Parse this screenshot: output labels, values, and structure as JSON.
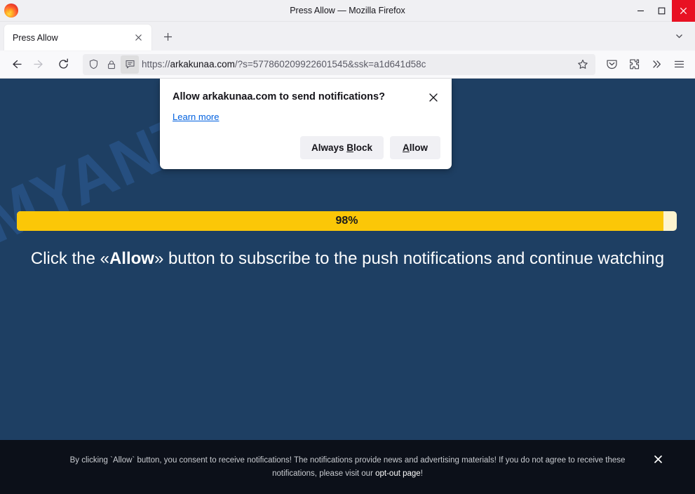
{
  "window": {
    "title": "Press Allow — Mozilla Firefox",
    "minimize_label": "Minimize",
    "maximize_label": "Maximize",
    "close_label": "Close"
  },
  "tabs": {
    "items": [
      {
        "title": "Press Allow",
        "active": true
      }
    ],
    "new_tab_label": "New tab",
    "list_tabs_label": "List all tabs"
  },
  "toolbar": {
    "back_label": "Go back one page",
    "forward_label": "Go forward one page",
    "reload_label": "Reload current page",
    "shield_label": "Enhanced Tracking Protection",
    "lock_label": "Connection secure",
    "permission_label": "Notification permission requested",
    "bookmark_label": "Bookmark this page",
    "pocket_label": "Save to Pocket",
    "extensions_label": "Extensions",
    "overflow_label": "More tools",
    "menu_label": "Open application menu"
  },
  "urlbar": {
    "scheme": "https://",
    "host": "arkakunaa.com",
    "path": "/?s=577860209922601545&ssk=a1d641d58c",
    "full": "https://arkakunaa.com/?s=577860209922601545&ssk=a1d641d58c"
  },
  "doorhanger": {
    "title": "Allow arkakunaa.com to send notifications?",
    "learn_more": "Learn more",
    "block_prefix": "Always ",
    "block_key": "B",
    "block_suffix": "lock",
    "allow_key": "A",
    "allow_suffix": "llow",
    "close_label": "Close"
  },
  "page": {
    "watermark": "MYANTISPYWARE.COM",
    "progress_label": "98%",
    "progress_percent": 98,
    "headline_before": "Click the «",
    "headline_bold": "Allow",
    "headline_after": "» button to subscribe to the push notifications and continue watching",
    "background_color": "#1e3f63",
    "progress_fill_color": "#fbc707",
    "progress_track_color": "#fdf4cf"
  },
  "banner": {
    "line1": "By clicking `Allow` button, you consent to receive notifications! The notifications provide news and advertising materials! If you do not agree to receive these",
    "line2_before": "notifications, please visit our ",
    "optout_link": "opt-out page",
    "line2_after": "!",
    "close_label": "Close banner",
    "background_color": "#0c1019"
  }
}
